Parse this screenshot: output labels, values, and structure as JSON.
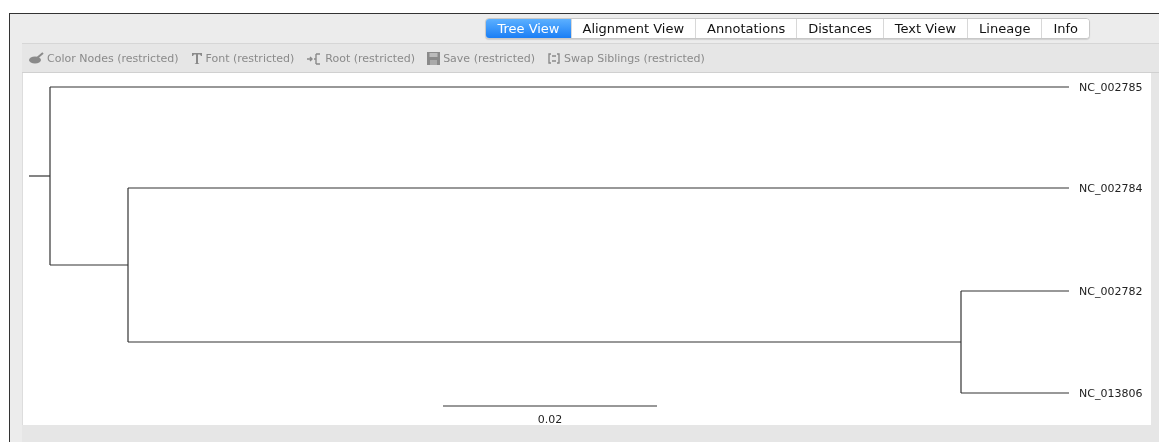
{
  "tabs": [
    {
      "label": "Tree View",
      "selected": true
    },
    {
      "label": "Alignment View",
      "selected": false
    },
    {
      "label": "Annotations",
      "selected": false
    },
    {
      "label": "Distances",
      "selected": false
    },
    {
      "label": "Text View",
      "selected": false
    },
    {
      "label": "Lineage",
      "selected": false
    },
    {
      "label": "Info",
      "selected": false
    }
  ],
  "toolbar": [
    {
      "kind": "brush",
      "label": "Color Nodes (restricted)",
      "disabled": true
    },
    {
      "kind": "font",
      "label": "Font (restricted)",
      "disabled": true
    },
    {
      "kind": "root",
      "label": "Root (restricted)",
      "disabled": true
    },
    {
      "kind": "save",
      "label": "Save (restricted)",
      "disabled": true
    },
    {
      "kind": "swap",
      "label": "Swap Siblings (restricted)",
      "disabled": true
    }
  ],
  "tree": {
    "children": [
      {
        "label": "NC_002785"
      },
      {
        "children": [
          {
            "label": "NC_002784"
          },
          {
            "children": [
              {
                "label": "NC_002782"
              },
              {
                "label": "NC_013806"
              }
            ]
          }
        ]
      }
    ]
  },
  "scale": {
    "label": "0.02"
  }
}
